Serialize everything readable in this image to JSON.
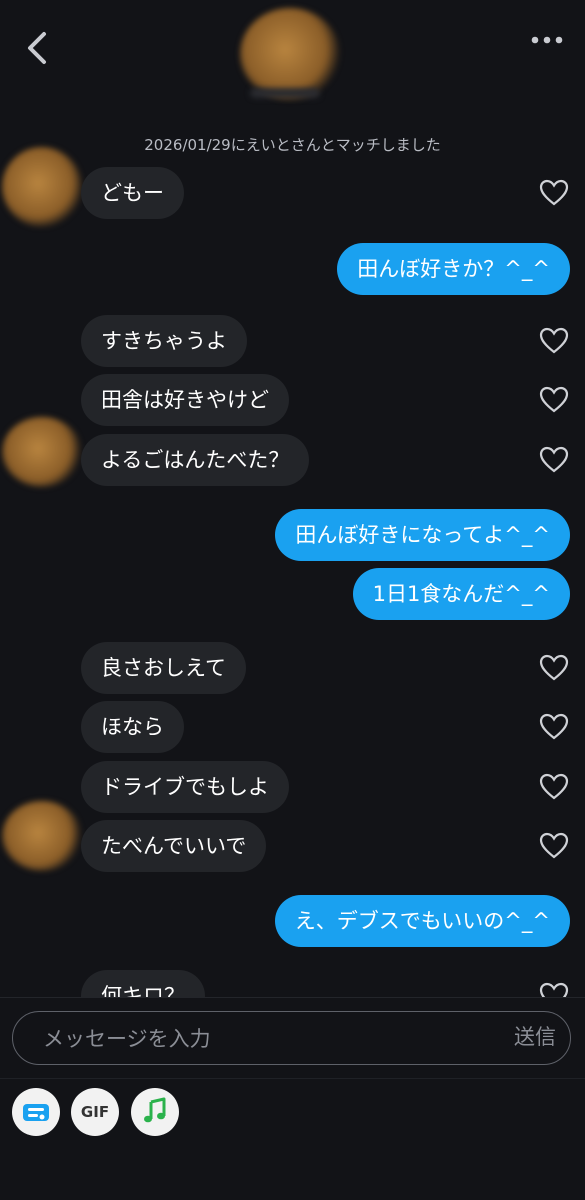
{
  "header": {
    "back_icon": "chevron-left-icon",
    "more_icon": "more-dots-icon"
  },
  "match_note": "2026/01/29にえいとさんとマッチしました",
  "messages": [
    {
      "side": "in",
      "text": "どもー"
    },
    {
      "side": "out",
      "text": "田んぼ好きか？^_^"
    },
    {
      "side": "in",
      "text": "すきちゃうよ"
    },
    {
      "side": "in",
      "text": "田舎は好きやけど"
    },
    {
      "side": "in",
      "text": "よるごはんたべた？"
    },
    {
      "side": "out",
      "text": "田んぼ好きになってよ^_^"
    },
    {
      "side": "out",
      "text": "1日1食なんだ^_^"
    },
    {
      "side": "in",
      "text": "良さおしえて"
    },
    {
      "side": "in",
      "text": "ほなら"
    },
    {
      "side": "in",
      "text": "ドライブでもしよ"
    },
    {
      "side": "in",
      "text": "たべんでいいで"
    },
    {
      "side": "out",
      "text": "え、デブスでもいいの^_^"
    },
    {
      "side": "in",
      "text": "何キロ？"
    }
  ],
  "composer": {
    "placeholder": "メッセージを入力",
    "send_label": "送信"
  },
  "toolbar": {
    "card_icon": "profile-card-icon",
    "gif_label": "GIF",
    "music_icon": "music-note-icon",
    "music_color": "#2bb24c"
  },
  "colors": {
    "background": "#121317",
    "incoming_bubble": "#232529",
    "outgoing_bubble": "#1aa1f0"
  }
}
